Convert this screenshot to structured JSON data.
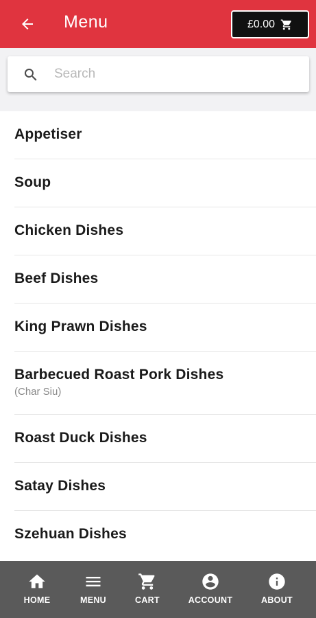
{
  "header": {
    "title": "Menu",
    "back_icon": "arrow-left-icon",
    "cart_total": "£0.00",
    "cart_icon": "shopping-cart-icon",
    "background_color": "#e0343f"
  },
  "search": {
    "placeholder": "Search",
    "value": ""
  },
  "categories": [
    {
      "label": "Appetiser",
      "sublabel": ""
    },
    {
      "label": "Soup",
      "sublabel": ""
    },
    {
      "label": "Chicken Dishes",
      "sublabel": ""
    },
    {
      "label": "Beef Dishes",
      "sublabel": ""
    },
    {
      "label": "King Prawn Dishes",
      "sublabel": ""
    },
    {
      "label": "Barbecued Roast Pork Dishes",
      "sublabel": "(Char Siu)"
    },
    {
      "label": "Roast Duck Dishes",
      "sublabel": ""
    },
    {
      "label": "Satay Dishes",
      "sublabel": ""
    },
    {
      "label": "Szehuan Dishes",
      "sublabel": ""
    }
  ],
  "bottom_nav": {
    "items": [
      {
        "label": "HOME",
        "icon": "home-icon"
      },
      {
        "label": "MENU",
        "icon": "menu-icon"
      },
      {
        "label": "CART",
        "icon": "cart-icon"
      },
      {
        "label": "ACCOUNT",
        "icon": "account-icon"
      },
      {
        "label": "ABOUT",
        "icon": "info-icon"
      }
    ],
    "background_color": "#5a5a5a"
  }
}
